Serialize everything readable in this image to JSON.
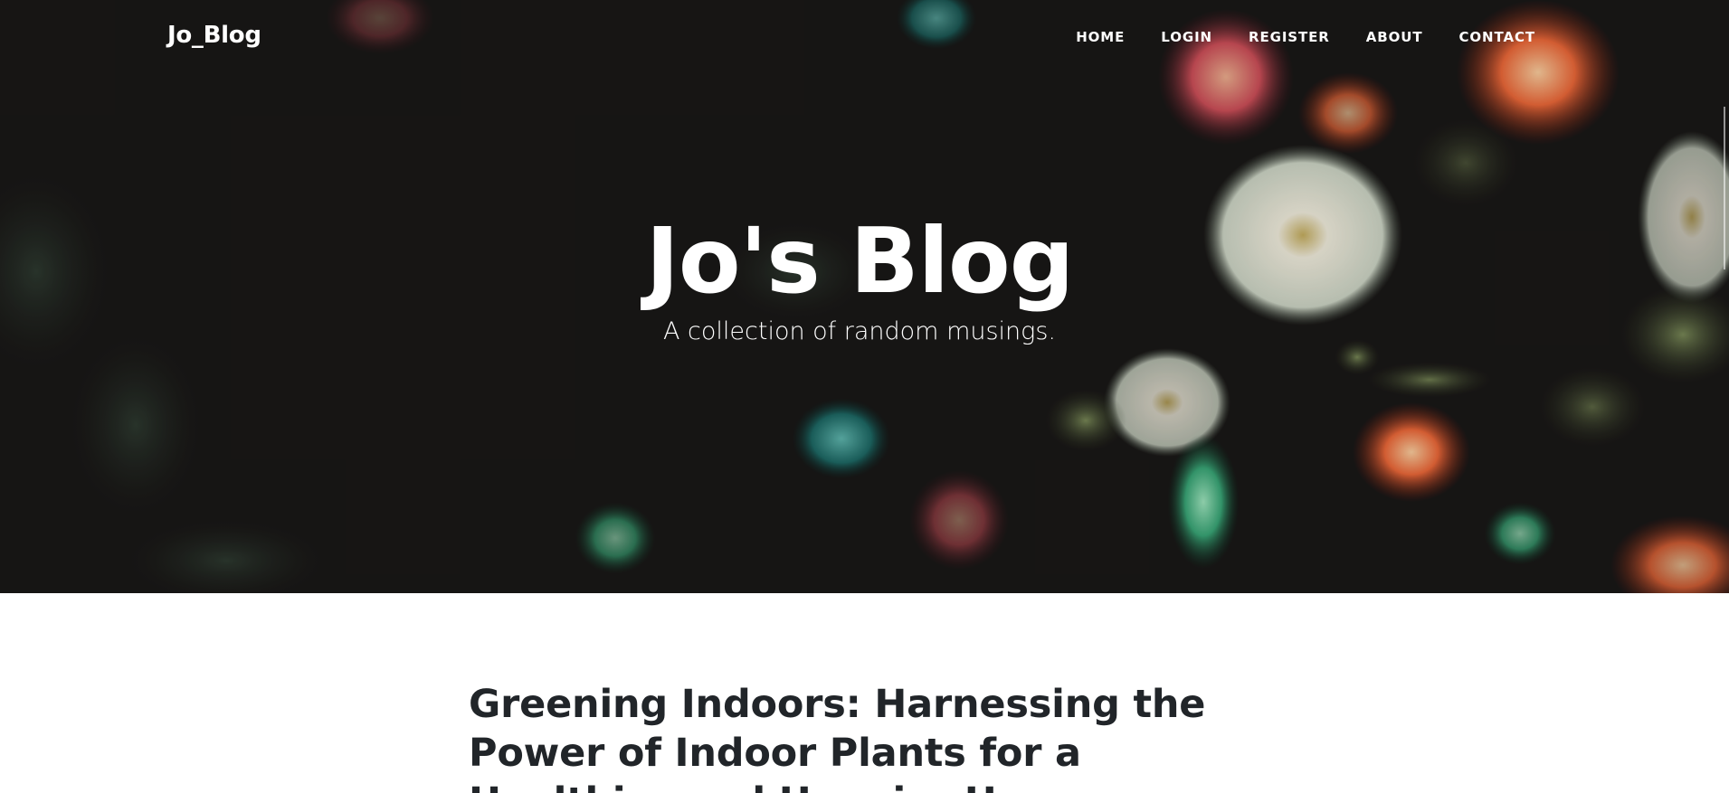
{
  "navbar": {
    "brand": "Jo_Blog",
    "links": [
      {
        "label": "HOME"
      },
      {
        "label": "LOGIN"
      },
      {
        "label": "REGISTER"
      },
      {
        "label": "ABOUT"
      },
      {
        "label": "CONTACT"
      }
    ]
  },
  "hero": {
    "title": "Jo's Blog",
    "subtitle": "A collection of random musings.",
    "background_image": "sea-anemones-aquarium-photo"
  },
  "posts": [
    {
      "title": "Greening Indoors: Harnessing the Power of Indoor Plants for a Healthier and Happier Home"
    }
  ],
  "colors": {
    "hero_background": "#191716",
    "nav_text": "#ffffff",
    "post_title": "#212529",
    "page_background": "#ffffff"
  }
}
